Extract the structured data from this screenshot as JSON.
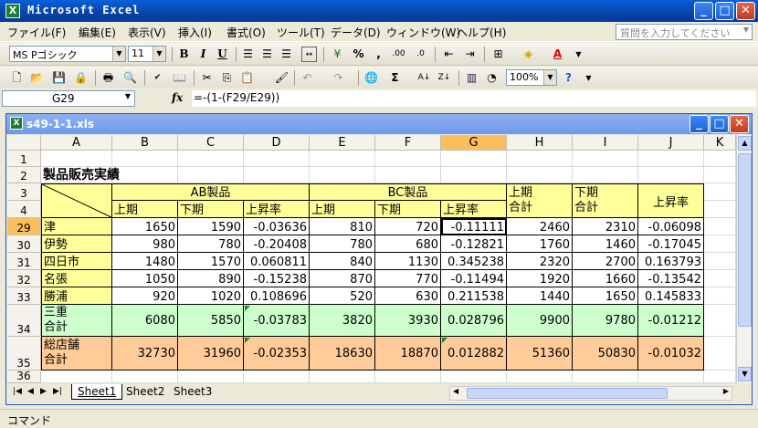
{
  "app": {
    "title": "Microsoft Excel"
  },
  "menu": {
    "items": [
      "ファイル(F)",
      "編集(E)",
      "表示(V)",
      "挿入(I)",
      "書式(O)",
      "ツール(T)",
      "データ(D)",
      "ウィンドウ(W)",
      "ヘルプ(H)"
    ],
    "ask_placeholder": "質問を入力してください"
  },
  "format_toolbar": {
    "font_name": "MS Pゴシック",
    "font_size": "11",
    "bold": "B",
    "italic": "I",
    "underline": "U",
    "percent": "%",
    "comma": ",",
    "inc_decimal": ".00",
    "dec_decimal": ".0"
  },
  "standard_toolbar": {
    "zoom": "100%",
    "sum": "Σ"
  },
  "formula_bar": {
    "name_box": "G29",
    "fx": "fx",
    "formula": "=-(1-(F29/E29))"
  },
  "workbook": {
    "title": "s49-1-1.xls"
  },
  "grid": {
    "columns": [
      "A",
      "B",
      "C",
      "D",
      "E",
      "F",
      "G",
      "H",
      "I",
      "J",
      "K"
    ],
    "rows": [
      "1",
      "2",
      "3",
      "4",
      "29",
      "30",
      "31",
      "32",
      "33",
      "34",
      "35",
      "36"
    ],
    "title": "製品販売実績",
    "ab_product": "AB製品",
    "bc_product": "BC製品",
    "first_half": "上期",
    "second_half": "下期",
    "rise_rate": "上昇率",
    "first_total_l1": "上期",
    "first_total_l2": "合計",
    "second_total_l1": "下期",
    "second_total_l2": "合計",
    "data_rows": [
      {
        "name": "津",
        "b": "1650",
        "c": "1590",
        "d": "-0.03636",
        "e": "810",
        "f": "720",
        "g": "-0.11111",
        "h": "2460",
        "i": "2310",
        "j": "-0.06098"
      },
      {
        "name": "伊勢",
        "b": "980",
        "c": "780",
        "d": "-0.20408",
        "e": "780",
        "f": "680",
        "g": "-0.12821",
        "h": "1760",
        "i": "1460",
        "j": "-0.17045"
      },
      {
        "name": "四日市",
        "b": "1480",
        "c": "1570",
        "d": "0.060811",
        "e": "840",
        "f": "1130",
        "g": "0.345238",
        "h": "2320",
        "i": "2700",
        "j": "0.163793"
      },
      {
        "name": "名張",
        "b": "1050",
        "c": "890",
        "d": "-0.15238",
        "e": "870",
        "f": "770",
        "g": "-0.11494",
        "h": "1920",
        "i": "1660",
        "j": "-0.13542"
      },
      {
        "name": "勝浦",
        "b": "920",
        "c": "1020",
        "d": "0.108696",
        "e": "520",
        "f": "630",
        "g": "0.211538",
        "h": "1440",
        "i": "1650",
        "j": "0.145833"
      }
    ],
    "mie_total": {
      "l1": "三重",
      "l2": "合計",
      "b": "6080",
      "c": "5850",
      "d": "-0.03783",
      "e": "3820",
      "f": "3930",
      "g": "0.028796",
      "h": "9900",
      "i": "9780",
      "j": "-0.01212"
    },
    "all_total": {
      "l1": "総店舗",
      "l2": "合計",
      "b": "32730",
      "c": "31960",
      "d": "-0.02353",
      "e": "18630",
      "f": "18870",
      "g": "0.012882",
      "h": "51360",
      "i": "50830",
      "j": "-0.01032"
    }
  },
  "sheets": [
    "Sheet1",
    "Sheet2",
    "Sheet3"
  ],
  "status": {
    "mode": "コマンド"
  }
}
